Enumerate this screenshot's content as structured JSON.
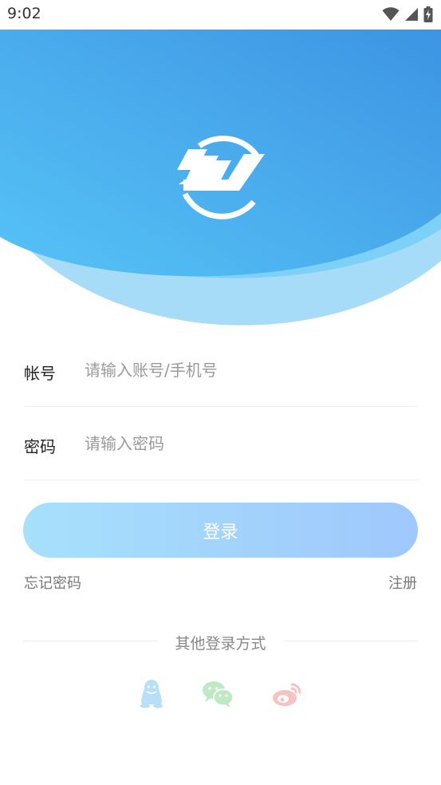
{
  "status_bar": {
    "time": "9:02",
    "icons": [
      "wifi-icon",
      "signal-icon",
      "battery-charging-icon"
    ]
  },
  "header": {
    "logo": "app-logo",
    "colors": {
      "primary": "#3f9ae6",
      "light": "#5fc7f7",
      "pale": "#a6dcf9"
    }
  },
  "form": {
    "account": {
      "label": "帐号",
      "placeholder": "请输入账号/手机号",
      "value": ""
    },
    "password": {
      "label": "密码",
      "placeholder": "请输入密码",
      "value": ""
    }
  },
  "login_button": {
    "label": "登录"
  },
  "links": {
    "forgot": "忘记密码",
    "register": "注册"
  },
  "other_login": {
    "title": "其他登录方式",
    "options": [
      {
        "name": "qq-icon",
        "color": "#b9def7"
      },
      {
        "name": "wechat-icon",
        "color": "#bfe8c4"
      },
      {
        "name": "weibo-icon",
        "color": "#f6c2c2"
      }
    ]
  }
}
